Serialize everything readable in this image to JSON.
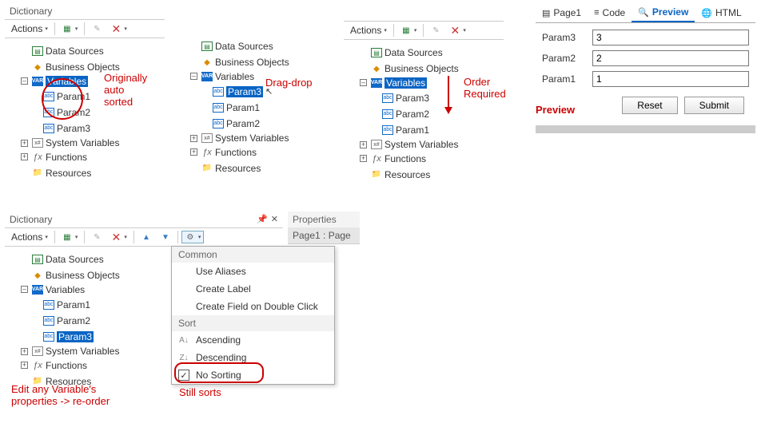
{
  "dict_title": "Dictionary",
  "toolbar": {
    "actions_label": "Actions",
    "new_label": "New"
  },
  "tree_items": {
    "data_sources": "Data Sources",
    "business_objects": "Business Objects",
    "variables": "Variables",
    "system_variables": "System Variables",
    "functions": "Functions",
    "resources": "Resources",
    "p1": "Param1",
    "p2": "Param2",
    "p3": "Param3"
  },
  "annotations": {
    "orig": "Originally\nauto\nsorted",
    "dragdrop": "Drag-drop",
    "order_req": "Order\nRequired",
    "preview": "Preview",
    "still_sorts": "Still sorts",
    "edit_reorder": "Edit any Variable's\nproperties -> re-order"
  },
  "tabs": {
    "page1": "Page1",
    "code": "Code",
    "preview": "Preview",
    "html": "HTML"
  },
  "preview_form": {
    "p3_label": "Param3",
    "p3_val": "3",
    "p2_label": "Param2",
    "p2_val": "2",
    "p1_label": "Param1",
    "p1_val": "1",
    "reset": "Reset",
    "submit": "Submit"
  },
  "properties": {
    "title": "Properties",
    "sub": "Page1 : Page"
  },
  "menu": {
    "common": "Common",
    "use_aliases": "Use Aliases",
    "create_label": "Create Label",
    "create_field": "Create Field on Double Click",
    "sort": "Sort",
    "asc": "Ascending",
    "desc": "Descending",
    "nosort": "No Sorting"
  }
}
